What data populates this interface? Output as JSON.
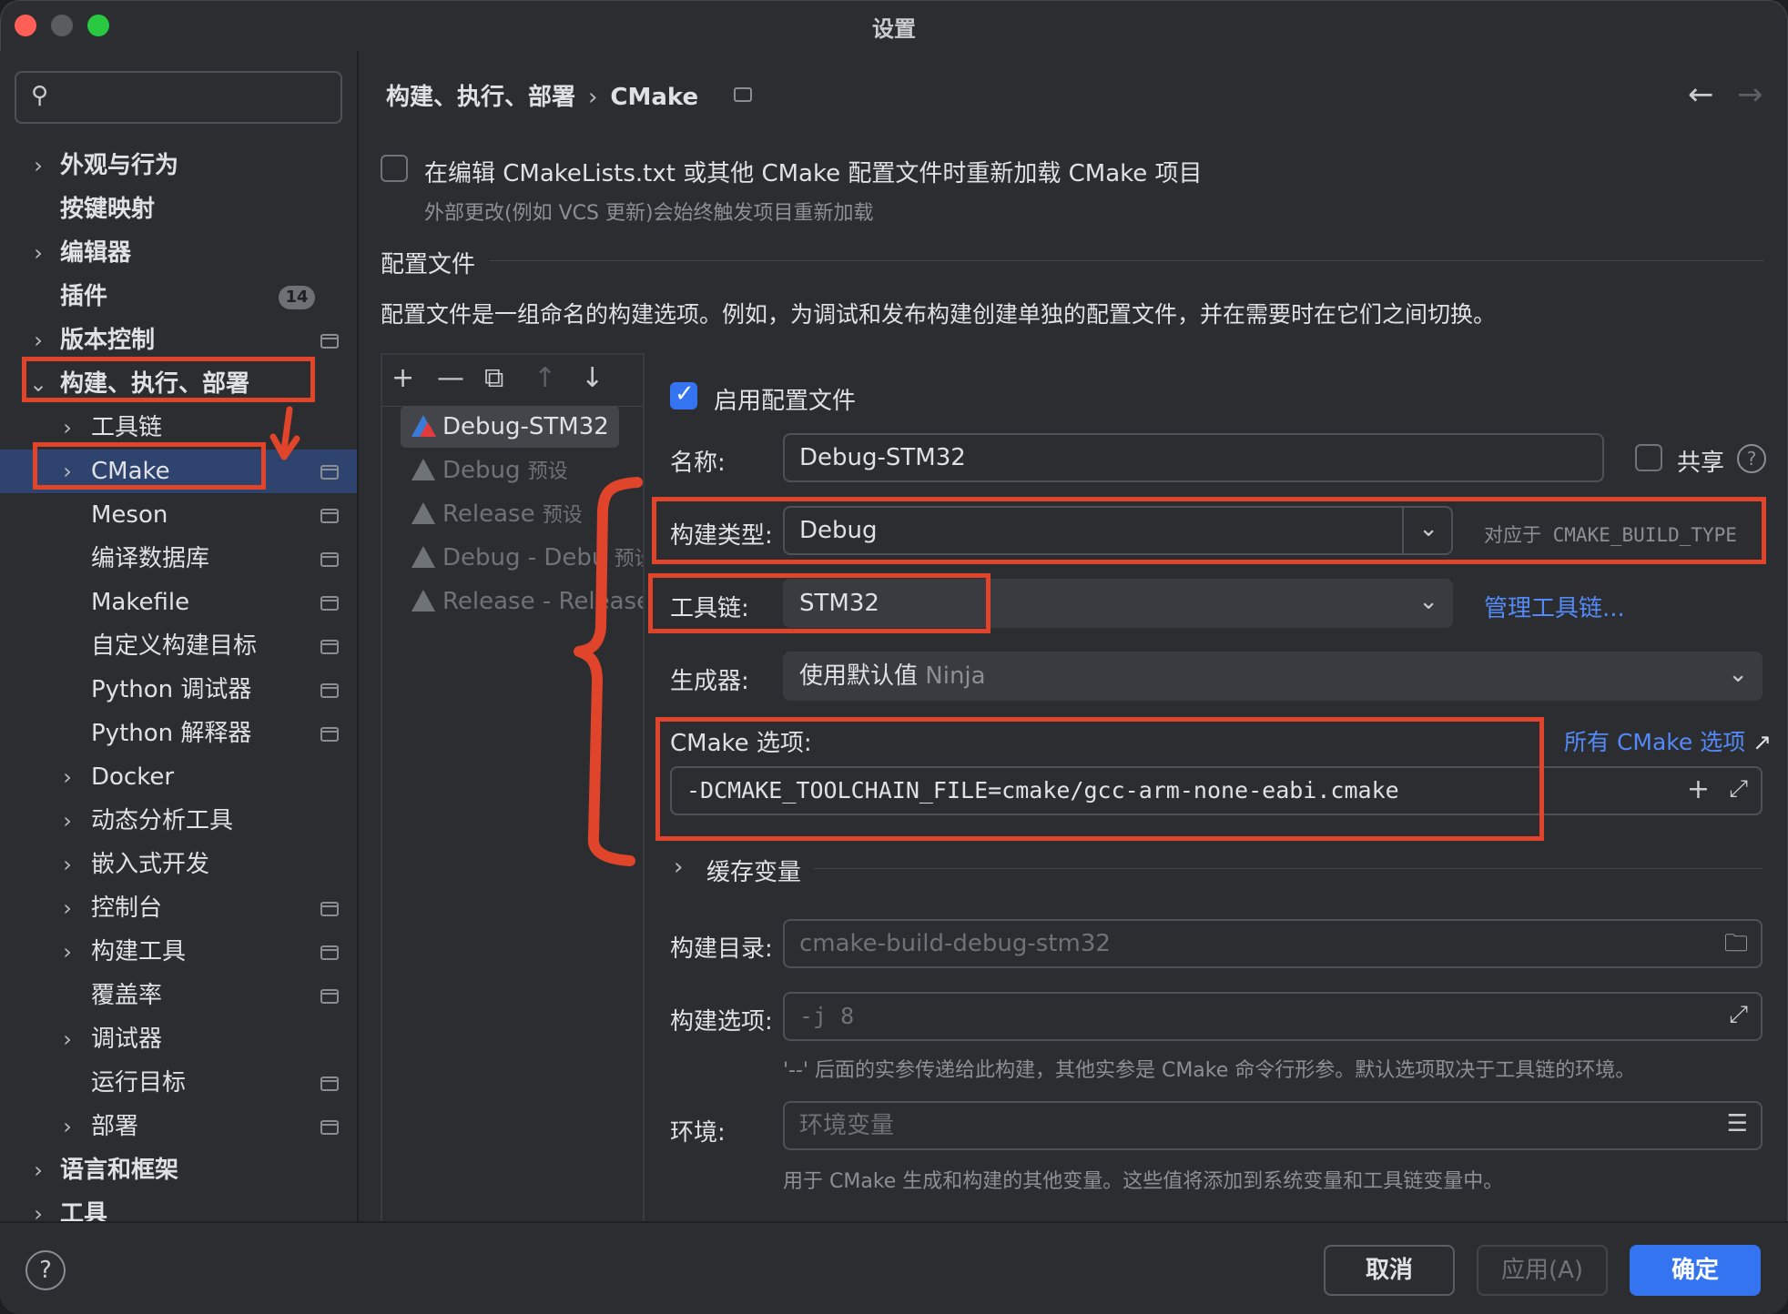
{
  "window": {
    "title": "设置"
  },
  "sidebar": {
    "search_placeholder": "",
    "items": [
      {
        "label": "外观与行为",
        "chevron": "›"
      },
      {
        "label": "按键映射",
        "chevron": ""
      },
      {
        "label": "编辑器",
        "chevron": "›"
      },
      {
        "label": "插件",
        "chevron": "",
        "badge": "14"
      },
      {
        "label": "版本控制",
        "chevron": "›"
      },
      {
        "label": "构建、执行、部署",
        "chevron": "⌄"
      },
      {
        "label": "工具链",
        "chevron": "›"
      },
      {
        "label": "CMake",
        "chevron": "›"
      },
      {
        "label": "Meson",
        "chevron": ""
      },
      {
        "label": "编译数据库",
        "chevron": ""
      },
      {
        "label": "Makefile",
        "chevron": ""
      },
      {
        "label": "自定义构建目标",
        "chevron": ""
      },
      {
        "label": "Python 调试器",
        "chevron": ""
      },
      {
        "label": "Python 解释器",
        "chevron": ""
      },
      {
        "label": "Docker",
        "chevron": "›"
      },
      {
        "label": "动态分析工具",
        "chevron": "›"
      },
      {
        "label": "嵌入式开发",
        "chevron": "›"
      },
      {
        "label": "控制台",
        "chevron": "›"
      },
      {
        "label": "构建工具",
        "chevron": "›"
      },
      {
        "label": "覆盖率",
        "chevron": ""
      },
      {
        "label": "调试器",
        "chevron": "›"
      },
      {
        "label": "运行目标",
        "chevron": ""
      },
      {
        "label": "部署",
        "chevron": "›"
      },
      {
        "label": "语言和框架",
        "chevron": "›"
      },
      {
        "label": "工具",
        "chevron": "›"
      }
    ]
  },
  "header": {
    "breadcrumb_parent": "构建、执行、部署",
    "breadcrumb_sep": "›",
    "breadcrumb_current": "CMake",
    "back_arrow": "←",
    "forward_arrow": "→"
  },
  "reload": {
    "label": "在编辑 CMakeLists.txt 或其他 CMake 配置文件时重新加载 CMake 项目",
    "hint": "外部更改(例如 VCS 更新)会始终触发项目重新加载",
    "checked": false
  },
  "profiles_section": {
    "title": "配置文件",
    "description": "配置文件是一组命名的构建选项。例如，为调试和发布构建创建单独的配置文件，并在需要时在它们之间切换。"
  },
  "profile_toolbar": {
    "add": "+",
    "remove": "—",
    "copy": "⧉",
    "up": "↑",
    "down": "↓"
  },
  "profiles": [
    {
      "name": "Debug-STM32",
      "suffix": "",
      "active": true
    },
    {
      "name": "Debug",
      "suffix": "预设",
      "active": false
    },
    {
      "name": "Release",
      "suffix": "预设",
      "active": false
    },
    {
      "name": "Debug - Debu",
      "suffix": "预设",
      "active": false
    },
    {
      "name": "Release - Release",
      "suffix": "",
      "active": false
    }
  ],
  "form": {
    "enable_label": "启用配置文件",
    "enable_checked": true,
    "name_label": "名称:",
    "name_value": "Debug-STM32",
    "share_label": "共享",
    "build_type_label": "构建类型:",
    "build_type_value": "Debug",
    "build_type_hint": "对应于 CMAKE_BUILD_TYPE",
    "toolchain_label": "工具链:",
    "toolchain_value": "STM32",
    "manage_toolchains": "管理工具链...",
    "generator_label": "生成器:",
    "generator_value": "使用默认值",
    "generator_hint": "Ninja",
    "cmake_options_label": "CMake 选项:",
    "all_cmake_options": "所有 CMake 选项",
    "cmake_options_value": "-DCMAKE_TOOLCHAIN_FILE=cmake/gcc-arm-none-eabi.cmake",
    "cache_vars_label": "缓存变量",
    "build_dir_label": "构建目录:",
    "build_dir_placeholder": "cmake-build-debug-stm32",
    "build_opts_label": "构建选项:",
    "build_opts_placeholder": "-j 8",
    "build_opts_hint": "'--' 后面的实参传递给此构建，其他实参是 CMake 命令行形参。默认选项取决于工具链的环境。",
    "env_label": "环境:",
    "env_placeholder": "环境变量",
    "env_hint": "用于 CMake 生成和构建的其他变量。这些值将添加到系统变量和工具链变量中。"
  },
  "footer": {
    "help": "?",
    "cancel": "取消",
    "apply": "应用(A)",
    "ok": "确定"
  },
  "colors": {
    "accent": "#3574f0",
    "annotation_red": "#e0442b",
    "link": "#548af7"
  }
}
